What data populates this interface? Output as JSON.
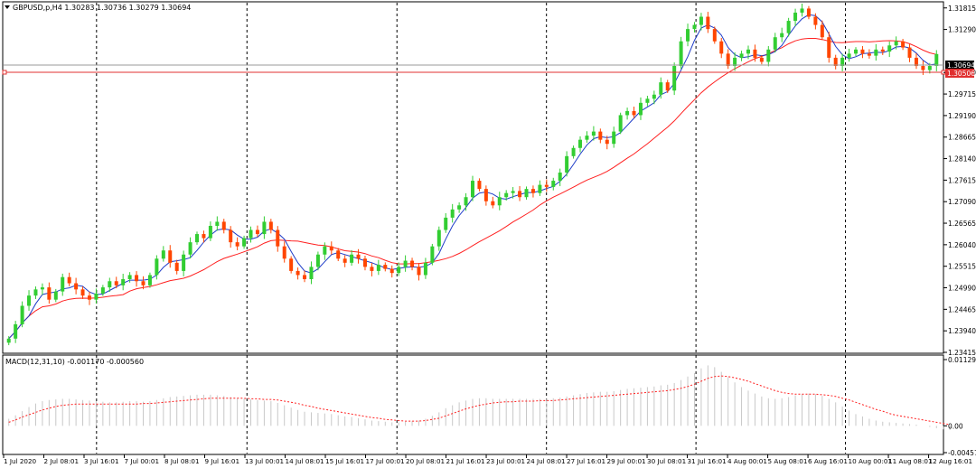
{
  "header": {
    "title": "GBPUSD,p,H4  1.30283 1.30736 1.30279 1.30694",
    "dropdown_icon": "triangle-down-icon"
  },
  "macd_label": "MACD(12,31,10) -0.001170 -0.000560",
  "price_axis": {
    "ticks": [
      "1.31815",
      "1.31290",
      "1.30240",
      "1.29715",
      "1.29190",
      "1.28665",
      "1.28140",
      "1.27615",
      "1.27090",
      "1.26565",
      "1.26040",
      "1.25515",
      "1.24990",
      "1.24465",
      "1.23940",
      "1.23415"
    ],
    "current_price": "1.30694",
    "line_price": "1.30506"
  },
  "macd_axis": {
    "ticks": [
      "0.01129",
      "0.00",
      "-0.00457"
    ]
  },
  "time_axis": {
    "labels": [
      "1 Jul 2020",
      "2 Jul 08:01",
      "3 Jul 16:01",
      "7 Jul 00:01",
      "8 Jul 08:01",
      "9 Jul 16:01",
      "13 Jul 00:01",
      "14 Jul 08:01",
      "15 Jul 16:01",
      "17 Jul 00:01",
      "20 Jul 08:01",
      "21 Jul 16:01",
      "23 Jul 00:01",
      "24 Jul 08:01",
      "27 Jul 16:01",
      "29 Jul 00:01",
      "30 Jul 08:01",
      "31 Jul 16:01",
      "4 Aug 00:01",
      "5 Aug 08:01",
      "6 Aug 16:01",
      "10 Aug 00:01",
      "11 Aug 08:01",
      "12 Aug 16:01"
    ]
  },
  "colors": {
    "bull": "#32cd32",
    "bear": "#ff4500",
    "fast_ma": "#1e3cc8",
    "slow_ma": "#ff2020",
    "price_line": "#e03030",
    "grid_separator": "#000000",
    "macd_hist": "#c8c8c8",
    "macd_signal": "#ff2020"
  },
  "chart_data": {
    "type": "candlestick",
    "symbol": "GBPUSD,p",
    "timeframe": "H4",
    "ohlc_last": {
      "open": 1.30283,
      "high": 1.30736,
      "low": 1.30279,
      "close": 1.30694
    },
    "y_range": [
      1.23415,
      1.3192
    ],
    "closes": [
      1.2375,
      1.241,
      1.2455,
      1.248,
      1.2495,
      1.25,
      1.247,
      1.249,
      1.2525,
      1.251,
      1.2495,
      1.248,
      1.247,
      1.2485,
      1.25,
      1.2515,
      1.2505,
      1.252,
      1.253,
      1.2515,
      1.2505,
      1.253,
      1.257,
      1.259,
      1.256,
      1.254,
      1.258,
      1.261,
      1.263,
      1.262,
      1.265,
      1.266,
      1.264,
      1.261,
      1.26,
      1.262,
      1.264,
      1.263,
      1.266,
      1.264,
      1.26,
      1.257,
      1.254,
      1.253,
      1.252,
      1.255,
      1.258,
      1.26,
      1.259,
      1.257,
      1.256,
      1.258,
      1.257,
      1.255,
      1.254,
      1.2555,
      1.2545,
      1.2535,
      1.255,
      1.2565,
      1.255,
      1.253,
      1.256,
      1.26,
      1.264,
      1.267,
      1.269,
      1.27,
      1.272,
      1.276,
      1.274,
      1.271,
      1.27,
      1.272,
      1.273,
      1.2735,
      1.272,
      1.274,
      1.273,
      1.275,
      1.2745,
      1.276,
      1.278,
      1.282,
      1.284,
      1.286,
      1.287,
      1.288,
      1.286,
      1.285,
      1.288,
      1.292,
      1.293,
      1.292,
      1.295,
      1.296,
      1.297,
      1.3,
      1.298,
      1.304,
      1.31,
      1.313,
      1.314,
      1.316,
      1.313,
      1.31,
      1.307,
      1.304,
      1.306,
      1.307,
      1.308,
      1.306,
      1.305,
      1.308,
      1.311,
      1.312,
      1.315,
      1.317,
      1.318,
      1.316,
      1.314,
      1.311,
      1.306,
      1.304,
      1.306,
      1.307,
      1.308,
      1.307,
      1.3065,
      1.308,
      1.3075,
      1.309,
      1.31,
      1.3085,
      1.306,
      1.304,
      1.303,
      1.304,
      1.3069
    ],
    "macd_hist": [
      0.0012,
      0.0018,
      0.0025,
      0.0032,
      0.0038,
      0.0042,
      0.0044,
      0.0045,
      0.0046,
      0.0046,
      0.0045,
      0.0044,
      0.0043,
      0.0042,
      0.0041,
      0.004,
      0.004,
      0.0041,
      0.0042,
      0.0042,
      0.0041,
      0.0042,
      0.0044,
      0.0047,
      0.0049,
      0.005,
      0.0051,
      0.0052,
      0.0053,
      0.0053,
      0.0053,
      0.0052,
      0.0051,
      0.0049,
      0.0047,
      0.0046,
      0.0045,
      0.0044,
      0.0043,
      0.0042,
      0.0039,
      0.0035,
      0.0031,
      0.0027,
      0.0024,
      0.0023,
      0.0022,
      0.0021,
      0.002,
      0.0018,
      0.0016,
      0.0015,
      0.0013,
      0.0011,
      0.0009,
      0.0008,
      0.0007,
      0.0006,
      0.0006,
      0.0007,
      0.0008,
      0.0009,
      0.0012,
      0.0017,
      0.0023,
      0.003,
      0.0035,
      0.004,
      0.0043,
      0.0046,
      0.0047,
      0.0047,
      0.0046,
      0.0046,
      0.0046,
      0.0046,
      0.0046,
      0.0046,
      0.0046,
      0.0046,
      0.0046,
      0.0047,
      0.0048,
      0.005,
      0.0052,
      0.0054,
      0.0056,
      0.0057,
      0.0058,
      0.0058,
      0.0059,
      0.0061,
      0.0063,
      0.0064,
      0.0065,
      0.0066,
      0.0067,
      0.0069,
      0.007,
      0.0073,
      0.0078,
      0.0084,
      0.009,
      0.0098,
      0.0103,
      0.01,
      0.0092,
      0.0083,
      0.0074,
      0.0066,
      0.006,
      0.0055,
      0.005,
      0.0047,
      0.0046,
      0.0047,
      0.0049,
      0.0052,
      0.0054,
      0.0055,
      0.0054,
      0.0051,
      0.0046,
      0.004,
      0.0033,
      0.0026,
      0.002,
      0.0016,
      0.0012,
      0.0009,
      0.0007,
      0.0006,
      0.0005,
      0.0004,
      0.0003,
      0.0002,
      0.0,
      -0.0002,
      -0.0004,
      -0.0006,
      -0.0007
    ],
    "macd_signal": [
      0.0006,
      0.001,
      0.0015,
      0.0019,
      0.0023,
      0.0027,
      0.003,
      0.0033,
      0.0035,
      0.0036,
      0.0037,
      0.0037,
      0.0037,
      0.0037,
      0.0037,
      0.0037,
      0.0037,
      0.0037,
      0.0037,
      0.0037,
      0.0038,
      0.0038,
      0.0039,
      0.004,
      0.0041,
      0.0042,
      0.0043,
      0.0044,
      0.0045,
      0.0046,
      0.0047,
      0.0047,
      0.0047,
      0.0047,
      0.0047,
      0.0047,
      0.0046,
      0.0046,
      0.0045,
      0.0045,
      0.0044,
      0.0042,
      0.004,
      0.0038,
      0.0035,
      0.0033,
      0.003,
      0.0028,
      0.0026,
      0.0024,
      0.0022,
      0.002,
      0.0018,
      0.0016,
      0.0014,
      0.0013,
      0.0011,
      0.001,
      0.0009,
      0.0008,
      0.0008,
      0.0008,
      0.0009,
      0.0011,
      0.0013,
      0.0017,
      0.0021,
      0.0025,
      0.0029,
      0.0032,
      0.0035,
      0.0037,
      0.0039,
      0.004,
      0.0041,
      0.0041,
      0.0042,
      0.0042,
      0.0042,
      0.0043,
      0.0043,
      0.0043,
      0.0044,
      0.0045,
      0.0046,
      0.0047,
      0.0048,
      0.0049,
      0.005,
      0.0051,
      0.0052,
      0.0053,
      0.0054,
      0.0055,
      0.0056,
      0.0057,
      0.0058,
      0.0059,
      0.006,
      0.0062,
      0.0064,
      0.0067,
      0.0071,
      0.0076,
      0.0081,
      0.0084,
      0.0085,
      0.0084,
      0.0082,
      0.0079,
      0.0076,
      0.0072,
      0.0068,
      0.0064,
      0.006,
      0.0057,
      0.0055,
      0.0054,
      0.0054,
      0.0054,
      0.0054,
      0.0053,
      0.0052,
      0.005,
      0.0047,
      0.0044,
      0.004,
      0.0036,
      0.0032,
      0.0028,
      0.0025,
      0.0021,
      0.0018,
      0.0016,
      0.0014,
      0.0012,
      0.001,
      0.0008,
      0.0006,
      0.0004,
      0.0002
    ]
  }
}
